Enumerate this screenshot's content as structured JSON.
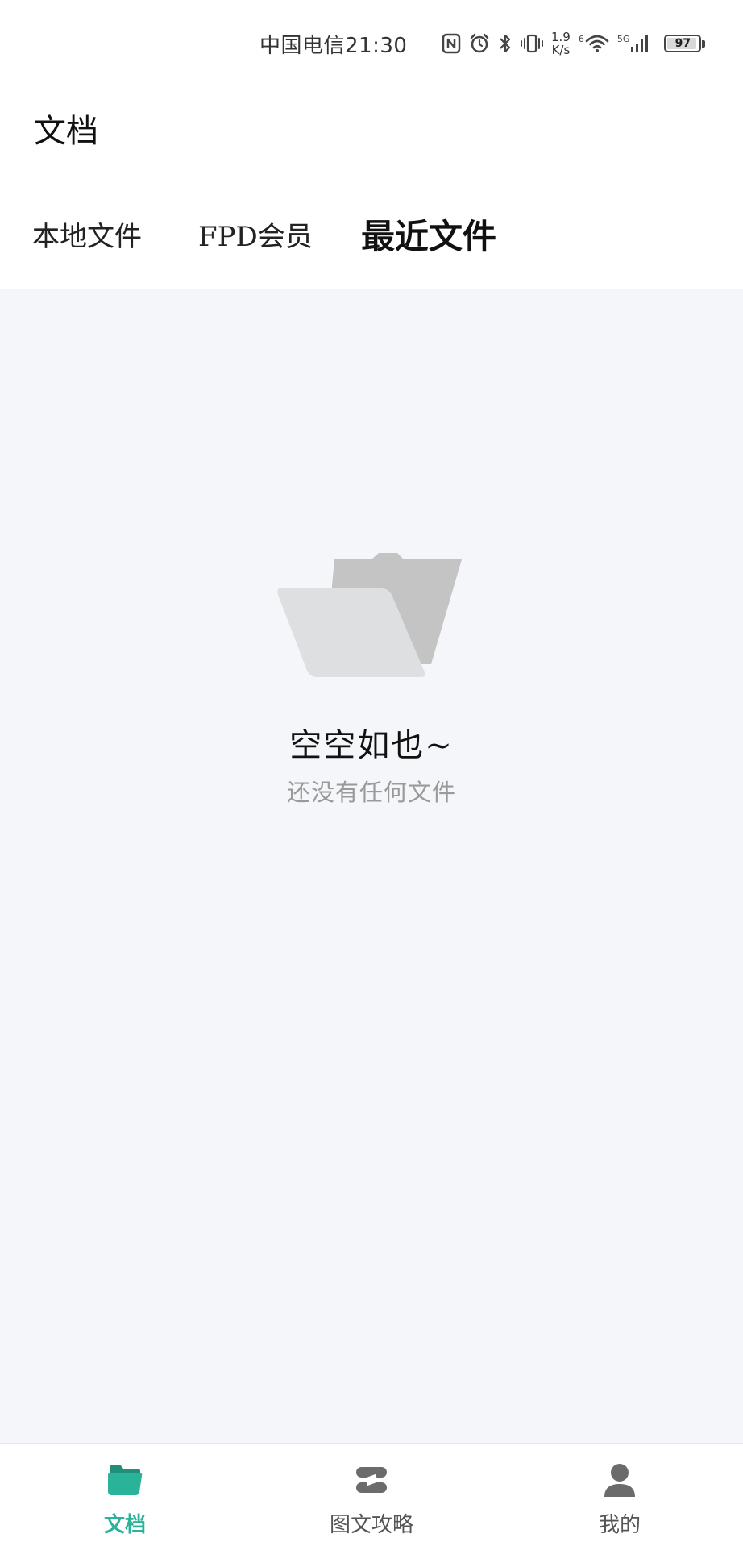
{
  "status_bar": {
    "carrier_time": "中国电信21:30",
    "network_speed_value": "1.9",
    "network_speed_unit": "K/s",
    "wifi_tag": "6",
    "signal_tag": "5G",
    "battery": "97",
    "battery_level_percent": 97
  },
  "header": {
    "title": "文档"
  },
  "tabs": [
    {
      "label": "本地文件",
      "active": false
    },
    {
      "label": "FPD会员",
      "active": false
    },
    {
      "label": "最近文件",
      "active": true
    }
  ],
  "empty_state": {
    "icon": "folder-icon",
    "title": "空空如也~",
    "subtitle": "还没有任何文件"
  },
  "bottom_nav": {
    "items": [
      {
        "label": "文档",
        "icon": "folder-icon",
        "active": true
      },
      {
        "label": "图文攻略",
        "icon": "guide-icon",
        "active": false
      },
      {
        "label": "我的",
        "icon": "profile-icon",
        "active": false
      }
    ]
  },
  "colors": {
    "accent": "#2bb39a",
    "content_background": "#f5f6f9",
    "muted_text": "#9a9a9a"
  }
}
